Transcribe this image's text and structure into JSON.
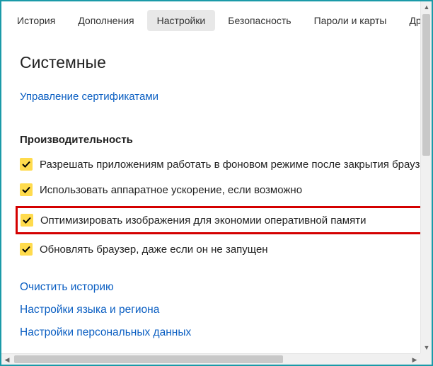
{
  "tabs": [
    {
      "label": "История",
      "active": false
    },
    {
      "label": "Дополнения",
      "active": false
    },
    {
      "label": "Настройки",
      "active": true
    },
    {
      "label": "Безопасность",
      "active": false
    },
    {
      "label": "Пароли и карты",
      "active": false
    },
    {
      "label": "Другие устро",
      "active": false
    }
  ],
  "page": {
    "title": "Системные",
    "cert_link": "Управление сертификатами"
  },
  "perf": {
    "title": "Производительность",
    "items": [
      {
        "label": "Разрешать приложениям работать в фоновом режиме после закрытия брауз",
        "checked": true,
        "highlight": false
      },
      {
        "label": "Использовать аппаратное ускорение, если возможно",
        "checked": true,
        "highlight": false
      },
      {
        "label": "Оптимизировать изображения для экономии оперативной памяти",
        "checked": true,
        "highlight": true
      },
      {
        "label": "Обновлять браузер, даже если он не запущен",
        "checked": true,
        "highlight": false
      }
    ]
  },
  "links": {
    "clear": "Очистить историю",
    "lang": "Настройки языка и региона",
    "personal": "Настройки персональных данных"
  }
}
